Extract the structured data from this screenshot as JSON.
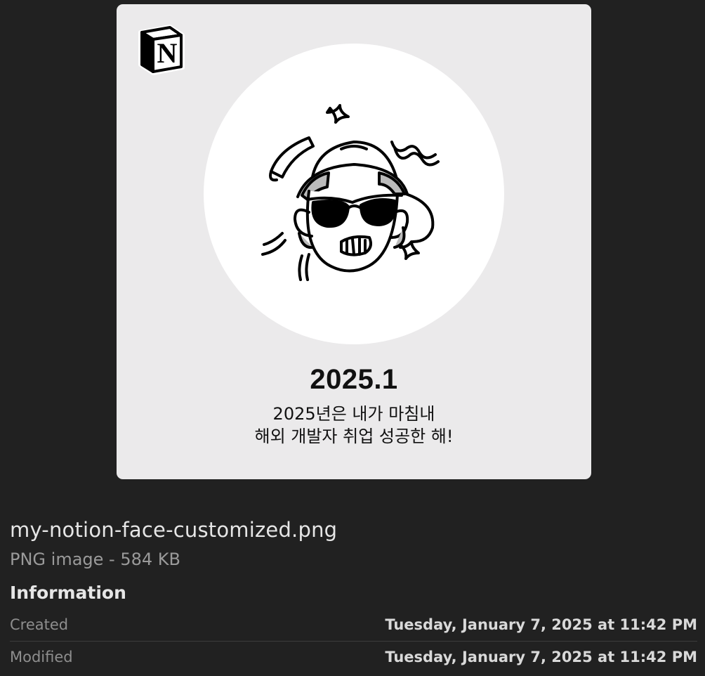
{
  "preview": {
    "year": "2025.1",
    "caption_line1": "2025년은 내가 마침내",
    "caption_line2": "해외 개발자 취업 성공한 해!",
    "logo_letter": "N"
  },
  "file": {
    "name": "my-notion-face-customized.png",
    "kind": "PNG image - 584 KB"
  },
  "information": {
    "title": "Information",
    "rows": [
      {
        "label": "Created",
        "value": "Tuesday, January 7, 2025 at 11:42 PM"
      },
      {
        "label": "Modified",
        "value": "Tuesday, January 7, 2025 at 11:42 PM"
      }
    ]
  },
  "colors": {
    "background": "#212121",
    "card": "#ebeaeb",
    "circle": "#ffffff",
    "primary_text": "#e6e6e6",
    "secondary_text": "#9a9a9a"
  },
  "icons": [
    "notion-logo-icon",
    "notion-face-illustration"
  ]
}
